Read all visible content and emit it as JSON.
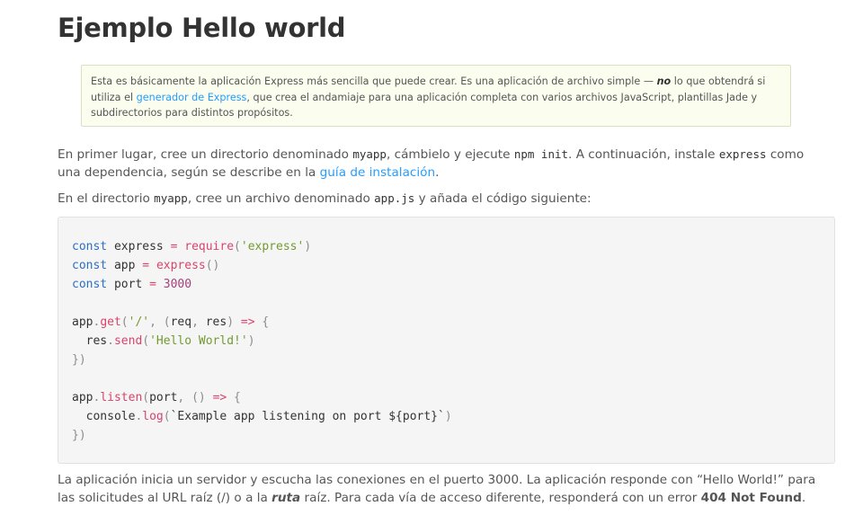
{
  "title": "Ejemplo Hello world",
  "note": {
    "text1": "Esta es básicamente la aplicación Express más sencilla que puede crear. Es una aplicación de archivo simple — ",
    "emph": "no",
    "text2": " lo que obtendrá si utiliza el ",
    "link": "generador de Express",
    "text3": ", que crea el andamiaje para una aplicación completa con varios archivos JavaScript, plantillas Jade y subdirectorios para distintos propósitos."
  },
  "para1": {
    "t1": "En primer lugar, cree un directorio denominado ",
    "c1": "myapp",
    "t2": ", cámbielo y ejecute ",
    "c2": "npm init",
    "t3": ". A continuación, instale ",
    "c3": "express",
    "t4": " como una dependencia, según se describe en la ",
    "link": "guía de instalación",
    "t5": "."
  },
  "para2": {
    "t1": "En el directorio ",
    "c1": "myapp",
    "t2": ", cree un archivo denominado ",
    "c2": "app.js",
    "t3": " y añada el código siguiente:"
  },
  "code": {
    "kw_const": "const",
    "v_express": "express",
    "v_app": "app",
    "v_port": "port",
    "op_eq": "=",
    "fn_require": "require",
    "s_express": "'express'",
    "fn_express": "express",
    "n_port": "3000",
    "fn_get": "get",
    "s_root": "'/'",
    "v_req": "req",
    "v_res": "res",
    "arrow": "=>",
    "fn_send": "send",
    "s_hello": "'Hello World!'",
    "fn_listen": "listen",
    "v_console": "console",
    "fn_log": "log",
    "s_tpl": "`Example app listening on port ${port}`"
  },
  "para3": {
    "t1": "La aplicación inicia un servidor y escucha las conexiones en el puerto 3000. La aplicación responde con “Hello World!” para las solicitudes al URL raíz (/) o a la ",
    "emph": "ruta",
    "t2": " raíz. Para cada vía de acceso diferente, responderá con un error ",
    "bold": "404 Not Found",
    "t3": "."
  }
}
